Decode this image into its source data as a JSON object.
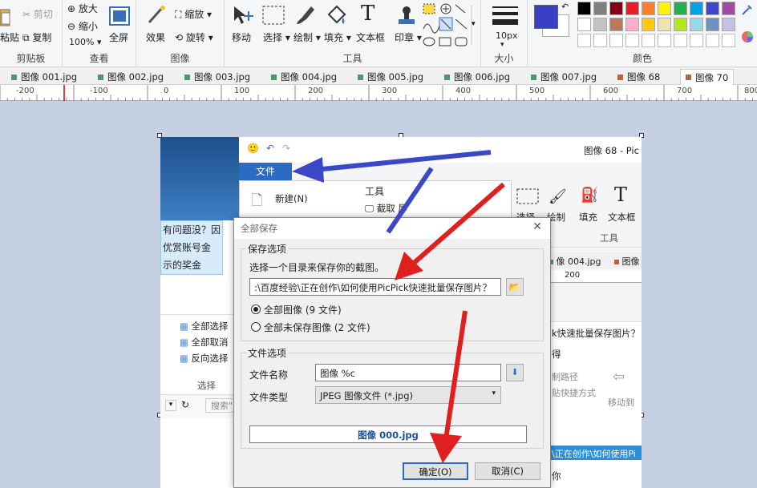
{
  "ribbon": {
    "clipboard": {
      "label": "剪贴板",
      "paste": "粘贴",
      "cut": "剪切",
      "copy": "复制"
    },
    "view": {
      "label": "查看",
      "zoom_in": "放大",
      "zoom_out": "缩小",
      "zoom_value": "100%",
      "fullscreen": "全屏"
    },
    "image": {
      "label": "图像",
      "effects": "效果",
      "scale": "缩放",
      "rotate": "旋转"
    },
    "tools": {
      "label": "工具",
      "move": "移动",
      "select": "选择",
      "draw": "绘制",
      "fill": "填充",
      "textbox": "文本框",
      "stamp": "印章"
    },
    "size": {
      "label": "大小",
      "value": "10px"
    },
    "colors": {
      "label": "颜色",
      "primary": "#3b3fc4",
      "palette": [
        "#000000",
        "#7f7f7f",
        "#880015",
        "#ed1c24",
        "#ff7f27",
        "#fff200",
        "#22b14c",
        "#00a2e8",
        "#3f48cc",
        "#a349a4",
        "#ffffff",
        "#c3c3c3",
        "#b97a57",
        "#ffaec9",
        "#ffc90e",
        "#efe4b0",
        "#b5e61d",
        "#99d9ea",
        "#7092be",
        "#c8bfe7"
      ]
    }
  },
  "tabs": [
    "图像 001.jpg",
    "图像 002.jpg",
    "图像 003.jpg",
    "图像 004.jpg",
    "图像 005.jpg",
    "图像 006.jpg",
    "图像 007.jpg",
    "图像 68",
    "图像 70"
  ],
  "ruler": [
    "-200",
    "-100",
    "0",
    "100",
    "200",
    "300",
    "400",
    "500",
    "600",
    "700",
    "800"
  ],
  "inner": {
    "title": "图像 68 - Pic",
    "file_tab": "文件",
    "new_item": "新建(N)",
    "tools_label": "工具",
    "capture": "截取",
    "screen": "屏",
    "bg_select": "选择",
    "bg_draw": "绘制",
    "bg_fill": "填充",
    "bg_textbox": "文本框",
    "bg_tools": "工具",
    "bg_tab": "像 004.jpg",
    "bg_tab2": "图像",
    "bg_ruler": "200",
    "left_text1": "有问题没？因",
    "left_text2": "优赏账号金",
    "left_text3": "示的奖金",
    "select_all": "全部选择",
    "deselect_all": "全部取消",
    "invert": "反向选择",
    "select_group": "选择",
    "search": "搜索\"",
    "right_title": "k快速批量保存图片？",
    "right_you": "得",
    "copy_path": "制路径",
    "paste_shortcut": "贴快捷方式",
    "move_to": "移动到",
    "path_bar": "\\正在创作\\如何使用Pi",
    "bottom_you": "你"
  },
  "dialog": {
    "title": "全部保存",
    "save_options": "保存选项",
    "choose_dir": "选择一个目录来保存你的截图。",
    "path": ":\\百度经验\\正在创作\\如何使用PicPick快速批量保存图片？",
    "all_images": "全部图像 (9 文件)",
    "unsaved_images": "全部未保存图像 (2 文件)",
    "file_options": "文件选项",
    "filename_label": "文件名称",
    "filename_value": "图像 %c",
    "filetype_label": "文件类型",
    "filetype_value": "JPEG 图像文件 (*.jpg)",
    "preview": "图像 000.jpg",
    "ok": "确定(O)",
    "cancel": "取消(C)"
  }
}
